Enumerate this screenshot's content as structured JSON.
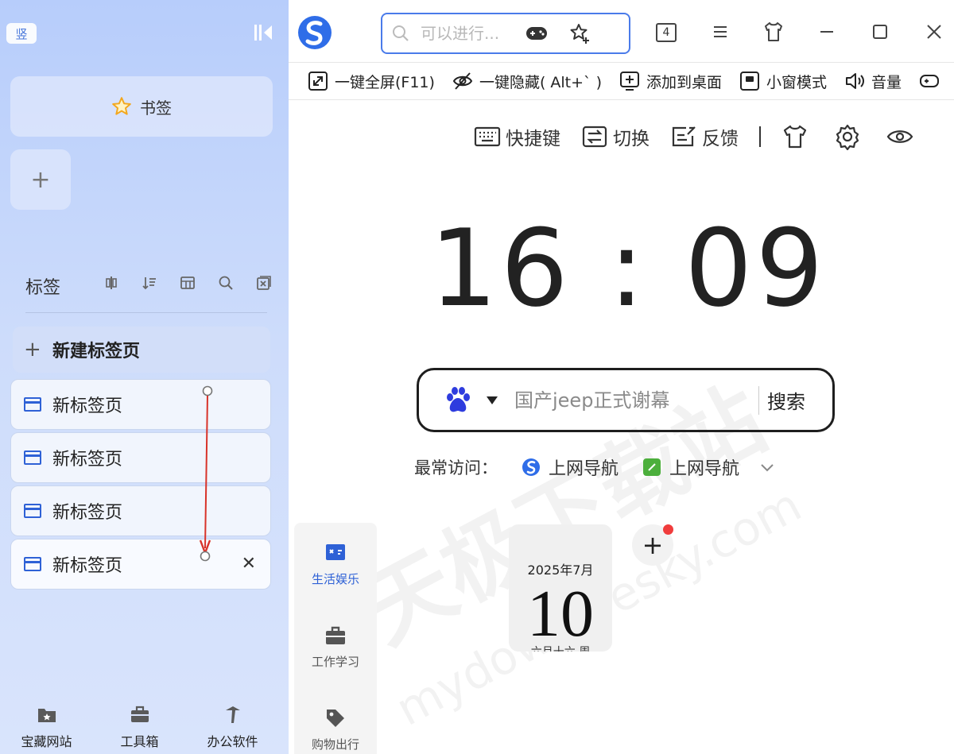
{
  "sidebar": {
    "vertical_badge": "竖",
    "bookmark_label": "书签",
    "add_label": "+",
    "tabs_title": "标签",
    "new_tab_label": "新建标签页",
    "tabs": [
      {
        "label": "新标签页"
      },
      {
        "label": "新标签页"
      },
      {
        "label": "新标签页"
      },
      {
        "label": "新标签页",
        "active": true
      }
    ],
    "bottom_nav": [
      {
        "label": "宝藏网站",
        "icon": "folder-star-icon"
      },
      {
        "label": "工具箱",
        "icon": "toolbox-icon"
      },
      {
        "label": "办公软件",
        "icon": "pin-icon"
      }
    ]
  },
  "header": {
    "address_placeholder": "可以进行...",
    "tab_count": "4"
  },
  "toolbar": [
    {
      "label": "一键全屏(F11)",
      "icon": "fullscreen-icon"
    },
    {
      "label": "一键隐藏( Alt+` )",
      "icon": "hide-eye-icon"
    },
    {
      "label": "添加到桌面",
      "icon": "add-desktop-icon"
    },
    {
      "label": "小窗模式",
      "icon": "mini-window-icon"
    },
    {
      "label": "音量",
      "icon": "volume-icon"
    }
  ],
  "ntp": {
    "tools": [
      {
        "label": "快捷键",
        "icon": "keyboard-icon"
      },
      {
        "label": "切换",
        "icon": "switch-icon"
      },
      {
        "label": "反馈",
        "icon": "feedback-icon"
      }
    ],
    "clock": "16 : 09",
    "search_placeholder": "国产jeep正式谢幕",
    "search_button": "搜索",
    "frequent_label": "最常访问：",
    "frequent_items": [
      {
        "label": "上网导航",
        "icon": "sogou-logo-icon"
      },
      {
        "label": "上网导航",
        "icon": "green-leaf-icon"
      }
    ],
    "categories": [
      {
        "label": "生活娱乐",
        "icon": "game-screen-icon",
        "active": true
      },
      {
        "label": "工作学习",
        "icon": "briefcase-icon"
      },
      {
        "label": "购物出行",
        "icon": "tag-icon"
      }
    ],
    "calendar": {
      "month": "2025年7月",
      "day": "10",
      "weekday": "六月十六 周"
    },
    "add_site_label": "+"
  },
  "watermark": {
    "text": "天极下载站",
    "sub": "mydown.yesky.com"
  },
  "colors": {
    "accent": "#2e61d6",
    "address_border": "#4a7bea",
    "notification_dot": "#f03c3c"
  }
}
